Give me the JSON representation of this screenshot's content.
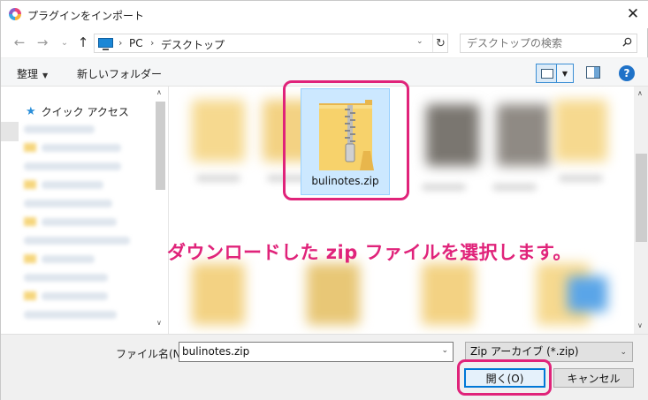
{
  "window": {
    "title": "プラグインをインポート",
    "close_icon": "close-icon"
  },
  "address": {
    "crumbs": [
      "PC",
      "デスクトップ"
    ],
    "search_placeholder": "デスクトップの検索"
  },
  "toolbar": {
    "organize_label": "整理",
    "new_folder_label": "新しいフォルダー",
    "help_label": "?"
  },
  "nav_pane": {
    "quick_access_label": "クイック アクセス"
  },
  "files": {
    "selected_file_name": "bulinotes.zip"
  },
  "annotation": {
    "text": "ダウンロードした zip ファイルを選択します。",
    "color": "#e0237a"
  },
  "footer": {
    "file_name_label": "ファイル名(N):",
    "file_name_value": "bulinotes.zip",
    "file_type_value": "Zip アーカイブ (*.zip)",
    "open_label": "開く(O)",
    "cancel_label": "キャンセル"
  },
  "colors": {
    "highlight": "#e0237a",
    "selection_bg": "#cce8ff",
    "accent_blue": "#0078d7"
  }
}
